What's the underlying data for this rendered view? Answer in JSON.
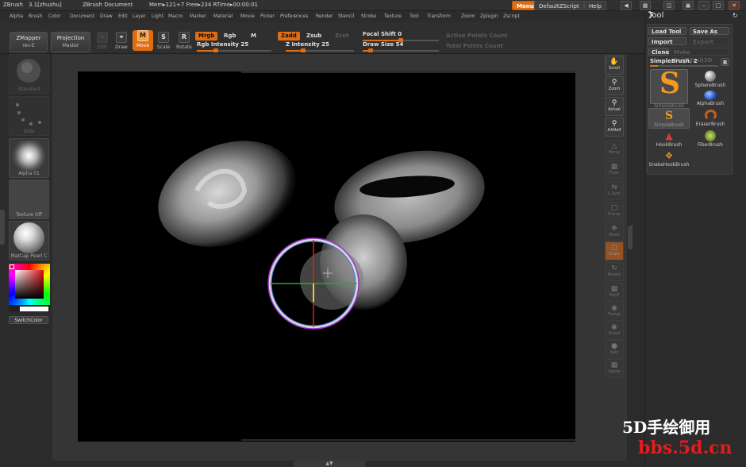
{
  "titlebar": {
    "app": "ZBrush",
    "version": "3.1[zhuzhu]",
    "document": "ZBrush Document",
    "mem": "Mem▸121+7 Free▸234 RTime▸00:00:01",
    "menus_btn": "Menus",
    "script_btn": "DefaultZScript",
    "help_btn": "Help"
  },
  "menubar": [
    "Alpha",
    "Brush",
    "Color",
    "Document",
    "Draw",
    "Edit",
    "Layer",
    "Light",
    "Macro",
    "Marker",
    "Material",
    "Movie",
    "Picker",
    "Preferences",
    "Render",
    "Stencil",
    "Stroke",
    "Texture",
    "Tool",
    "Transform",
    "Zoom",
    "Zplugin",
    "Zscript"
  ],
  "toolbar": {
    "zmapper": "ZMapper",
    "zmapper_sub": "rev-E",
    "projection": "Projection",
    "projection_sub": "Master",
    "edit": "Edit",
    "draw": "Draw",
    "move": "Move",
    "scale": "Scale",
    "rotate": "Rotate",
    "mrgb": "Mrgb",
    "rgb": "Rgb",
    "m": "M",
    "rgb_intensity": "Rgb Intensity 25",
    "zadd": "Zadd",
    "zsub": "Zsub",
    "zcut": "Zcut",
    "z_intensity": "Z Intensity 25",
    "focal_shift": "Focal Shift 0",
    "draw_size": "Draw Size 54",
    "active_points": "Active Points Count",
    "total_points": "Total Points Count",
    "rgb_intensity_value": 25,
    "z_intensity_value": 25,
    "focal_shift_value": 0,
    "draw_size_value": 54
  },
  "lefttray": {
    "standard": "Standard",
    "dots": "Dots",
    "alpha": "Alpha 01",
    "texture": "Texture Off",
    "matcap": "MatCap Pearl C",
    "switch_color": "SwitchColor"
  },
  "rightshelf": [
    "Scroll",
    "Zoom",
    "Actual",
    "AAHalf",
    "Persp",
    "Floor",
    "L.Sym",
    "Frame",
    "Move",
    "Scale",
    "Rotate",
    "PolyF",
    "Transp",
    "Ghost",
    "Solo",
    "Xpose"
  ],
  "toolpanel": {
    "title": "Tool",
    "load_tool": "Load Tool",
    "save_as": "Save As",
    "import": "Import",
    "export": "Export",
    "clone": "Clone",
    "make_polymesh": "Make PolyMesh3D",
    "current": "SimpleBrush. 2",
    "r": "R",
    "brushes": [
      {
        "label": "SimpleBrush",
        "icon": "simplebrush-large-icon"
      },
      {
        "label": "SphereBrush",
        "icon": "spherebrush-icon"
      },
      {
        "label": "AlphaBrush",
        "icon": "alphabrush-icon"
      },
      {
        "label": "SimpleBrush",
        "icon": "simplebrush-icon"
      },
      {
        "label": "EraserBrush",
        "icon": "eraserbrush-icon"
      },
      {
        "label": "HookBrush",
        "icon": "hookbrush-icon"
      },
      {
        "label": "FiberBrush",
        "icon": "fiberbrush-icon"
      },
      {
        "label": "SnakeHookBrush",
        "icon": "snakehookbrush-icon"
      }
    ]
  },
  "watermark": {
    "line1": "5D手绘御用",
    "line2": "bbs.5d.cn"
  },
  "colors": {
    "accent": "#e06d14",
    "watermark_red": "#e21d1d"
  }
}
